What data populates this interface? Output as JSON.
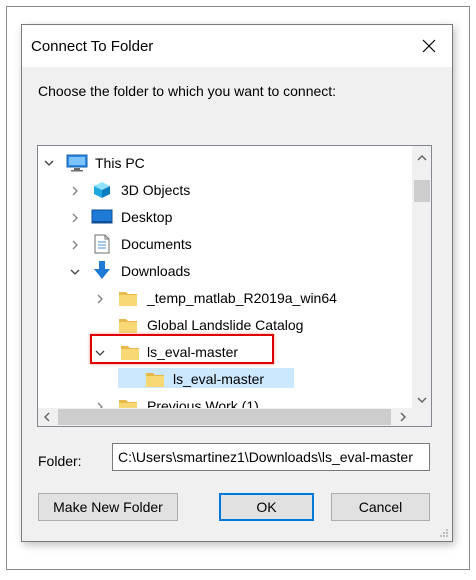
{
  "window": {
    "title": "Connect To Folder"
  },
  "prompt": "Choose the folder to which you want to connect:",
  "tree": {
    "items": [
      {
        "label": "This PC",
        "icon": "pc-icon",
        "chevron": "down"
      },
      {
        "label": "3D Objects",
        "icon": "3d-objects-icon",
        "chevron": "right"
      },
      {
        "label": "Desktop",
        "icon": "desktop-icon",
        "chevron": "right"
      },
      {
        "label": "Documents",
        "icon": "documents-icon",
        "chevron": "right"
      },
      {
        "label": "Downloads",
        "icon": "downloads-icon",
        "chevron": "down"
      },
      {
        "label": "_temp_matlab_R2019a_win64",
        "icon": "folder-icon",
        "chevron": "right"
      },
      {
        "label": "Global Landslide Catalog",
        "icon": "folder-icon",
        "chevron": "none"
      },
      {
        "label": "ls_eval-master",
        "icon": "folder-icon",
        "chevron": "down",
        "selected": true
      },
      {
        "label": "ls_eval-master",
        "icon": "folder-icon",
        "chevron": "none"
      },
      {
        "label": "Previous Work (1)",
        "icon": "folder-icon",
        "chevron": "right"
      }
    ]
  },
  "folder": {
    "label": "Folder:",
    "value": "C:\\Users\\smartinez1\\Downloads\\ls_eval-master"
  },
  "buttons": {
    "make_new_folder": "Make New Folder",
    "ok": "OK",
    "cancel": "Cancel"
  },
  "colors": {
    "selection": "#cce8ff",
    "highlight_box": "#e00000",
    "accent": "#0078d7",
    "folder": "#f8d775"
  }
}
